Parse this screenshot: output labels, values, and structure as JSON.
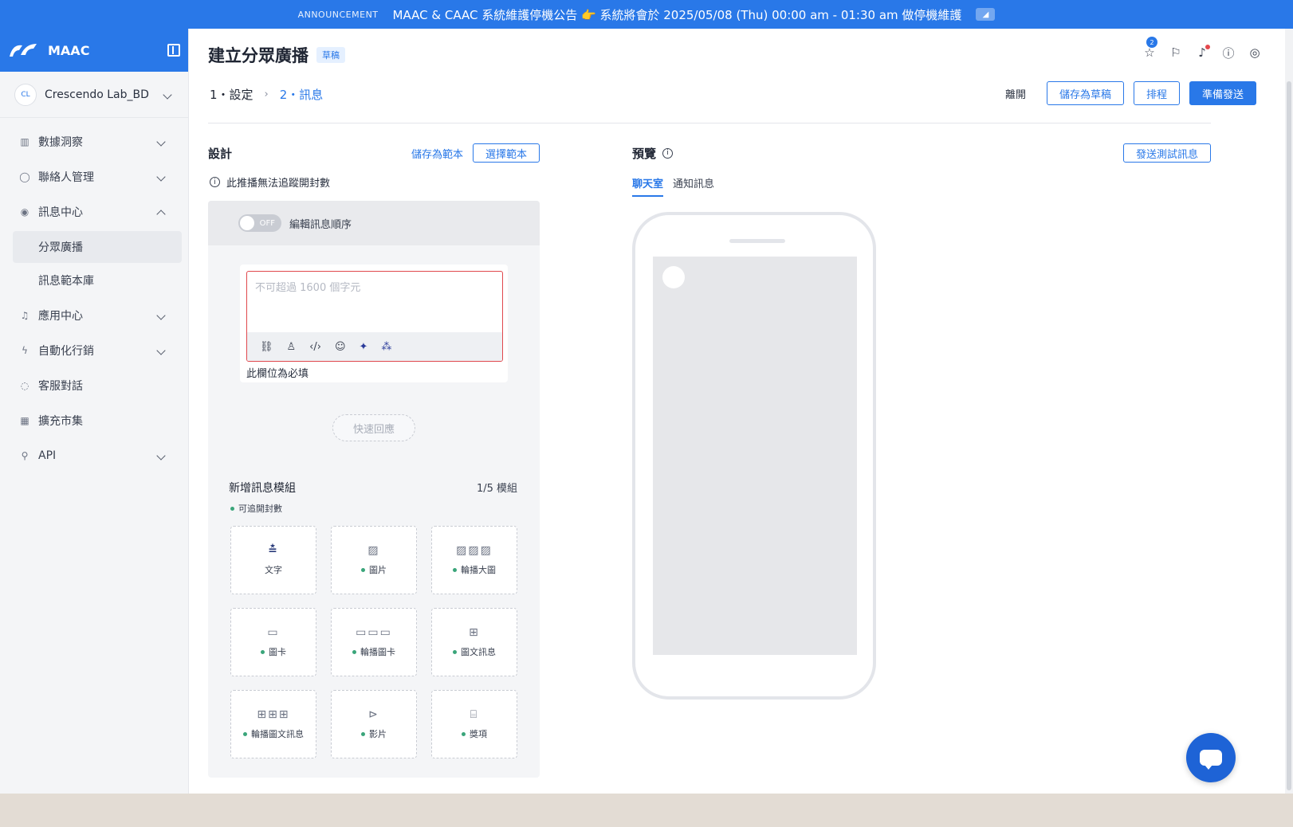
{
  "announcement": {
    "tag": "ANNOUNCEMENT",
    "message": "MAAC & CAAC 系統維護停機公告 👉 系統將會於 2025/05/08 (Thu) 00:00 am - 01:30 am 做停機維護"
  },
  "brand": {
    "name": "MAAC"
  },
  "org": {
    "name": "Crescendo Lab_BD",
    "logo_text": "CL"
  },
  "sidebar": {
    "items": [
      {
        "label": "數據洞察",
        "icon": "chart-icon"
      },
      {
        "label": "聯絡人管理",
        "icon": "user-icon"
      },
      {
        "label": "訊息中心",
        "icon": "broadcast-icon"
      },
      {
        "label": "分眾廣播"
      },
      {
        "label": "訊息範本庫"
      },
      {
        "label": "應用中心",
        "icon": "bell-icon"
      },
      {
        "label": "自動化行銷",
        "icon": "bolt-icon"
      },
      {
        "label": "客服對話",
        "icon": "chat-icon"
      },
      {
        "label": "擴充市集",
        "icon": "store-icon"
      },
      {
        "label": "API",
        "icon": "link-icon"
      }
    ]
  },
  "header": {
    "title": "建立分眾廣播",
    "badge": "草稿",
    "star_count": "2"
  },
  "steps": {
    "step1": "1・設定",
    "sep": "›",
    "step2": "2・訊息"
  },
  "actions": {
    "leave": "離開",
    "save_draft": "儲存為草稿",
    "schedule": "排程",
    "send": "準備發送"
  },
  "design": {
    "title": "設計",
    "save_template": "儲存為範本",
    "choose_template": "選擇範本",
    "warning": "此推播無法追蹤開封數",
    "toggle_state": "OFF",
    "toggle_label": "編輯訊息順序",
    "textbox_placeholder": "不可超過 1600 個字元",
    "required_error": "此欄位為必填",
    "quick_reply": "快速回應",
    "modules_title": "新增訊息模組",
    "modules_count": "1/5 模組",
    "trackable_note": "可追開封數",
    "modules": [
      {
        "label": "文字",
        "icon": "text-icon"
      },
      {
        "label": "圖片",
        "icon": "image-icon"
      },
      {
        "label": "輪播大圖",
        "icon": "image-carousel-icon"
      },
      {
        "label": "圖卡",
        "icon": "card-icon"
      },
      {
        "label": "輪播圖卡",
        "icon": "card-carousel-icon"
      },
      {
        "label": "圖文訊息",
        "icon": "grid-icon"
      },
      {
        "label": "輪播圖文訊息",
        "icon": "grid-carousel-icon"
      },
      {
        "label": "影片",
        "icon": "video-icon"
      },
      {
        "label": "獎項",
        "icon": "gift-icon"
      }
    ]
  },
  "preview": {
    "title": "預覽",
    "send_test": "發送測試訊息",
    "tabs": [
      "聊天室",
      "通知訊息"
    ]
  }
}
